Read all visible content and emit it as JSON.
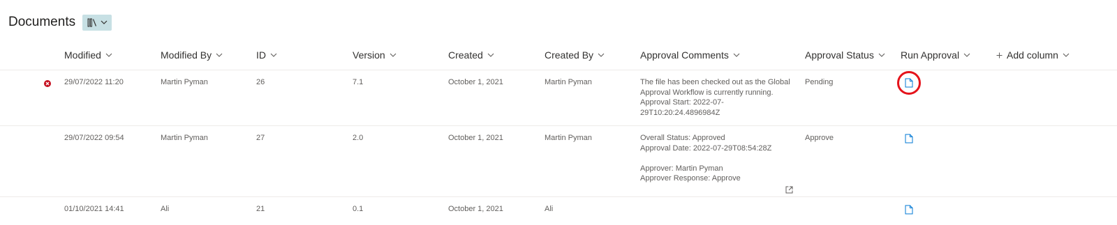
{
  "library": {
    "title": "Documents",
    "view_icon": "library-icon"
  },
  "columns": {
    "modified": "Modified",
    "modified_by": "Modified By",
    "id": "ID",
    "version": "Version",
    "created": "Created",
    "created_by": "Created By",
    "approval_comments": "Approval Comments",
    "approval_status": "Approval Status",
    "run_approval": "Run Approval",
    "add_column": "Add column"
  },
  "rows": [
    {
      "status_icon": "checked-out-icon",
      "modified": "29/07/2022 11:20",
      "modified_by": "Martin Pyman",
      "id": "26",
      "version": "7.1",
      "created": "October 1, 2021",
      "created_by": "Martin Pyman",
      "comments": [
        "The file has been checked out as the Global",
        "Approval Workflow is currently running.",
        "Approval Start: 2022-07-",
        "29T10:20:24.4896984Z"
      ],
      "approval_status": "Pending",
      "run_approval_icon": "document-icon"
    },
    {
      "modified": "29/07/2022 09:54",
      "modified_by": "Martin Pyman",
      "id": "27",
      "version": "2.0",
      "created": "October 1, 2021",
      "created_by": "Martin Pyman",
      "comments": [
        "Overall Status: Approved",
        "Approval Date: 2022-07-29T08:54:28Z",
        "",
        "Approver: Martin Pyman",
        "Approver Response: Approve"
      ],
      "approval_status": "Approve",
      "run_approval_icon": "document-icon"
    },
    {
      "modified": "01/10/2021 14:41",
      "modified_by": "Ali",
      "id": "21",
      "version": "0.1",
      "created": "October 1, 2021",
      "created_by": "Ali",
      "run_approval_icon": "document-icon"
    }
  ],
  "colors": {
    "accent": "#0078d4",
    "checked_out": "#c50f1f",
    "highlight": "#e5131b",
    "view_switch_bg": "#c7e0e4"
  }
}
